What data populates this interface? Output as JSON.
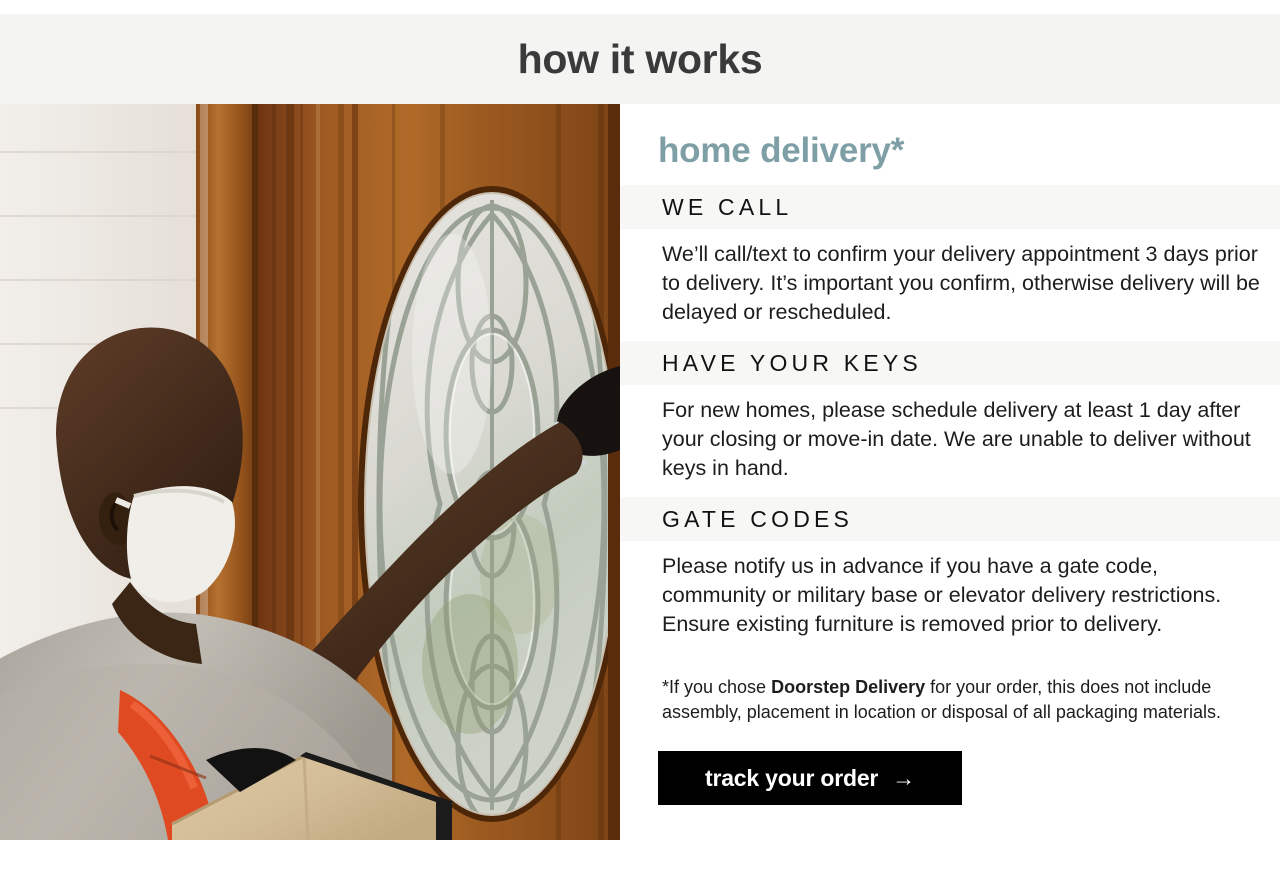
{
  "header": {
    "title": "how it works",
    "background_color": "#f4f4f3",
    "text_color": "#3a3a3a"
  },
  "photo": {
    "alt": "Delivery associate wearing a face mask and orange safety vest knocking on a wooden front door with an oval leaded-glass window, a cardboard box on the porch beside him",
    "icon_name": "delivery-photo"
  },
  "delivery": {
    "title": "home delivery*",
    "title_color": "#7f9fa6",
    "sections": [
      {
        "heading": "WE CALL",
        "body": "We’ll call/text to confirm your delivery appointment 3 days prior to delivery. It’s important you confirm, otherwise delivery will be delayed or rescheduled."
      },
      {
        "heading": "HAVE YOUR KEYS",
        "body": "For new homes, please schedule delivery at least 1 day after your closing or move-in date. We are unable to deliver without keys in hand."
      },
      {
        "heading": "GATE CODES",
        "body": "Please notify us in advance if you have a gate code, community or military base or elevator delivery restrictions. Ensure existing furniture is removed prior to delivery."
      }
    ],
    "footnote": {
      "lead": "*If you chose ",
      "bold": "Doorstep Delivery",
      "tail": " for your order, this does not include assembly, placement in location or disposal of all packaging materials."
    },
    "cta": {
      "label": "track your order",
      "arrow": "→",
      "background_color": "#000000",
      "text_color": "#ffffff"
    }
  }
}
